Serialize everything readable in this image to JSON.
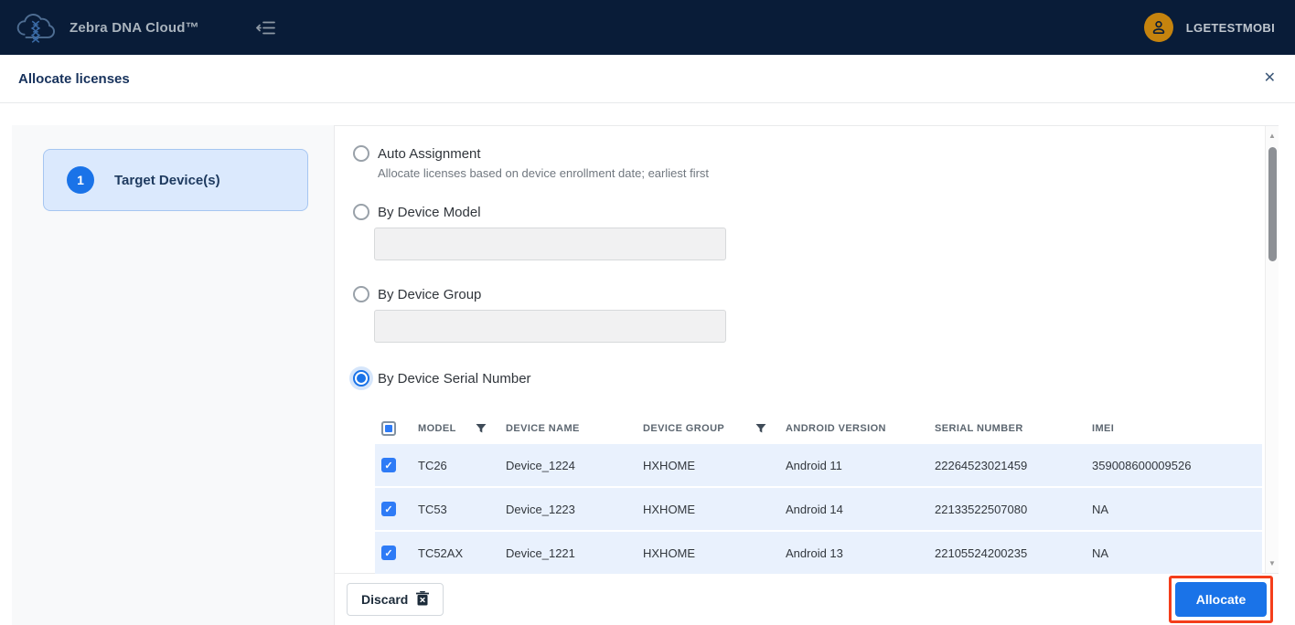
{
  "colors": {
    "header_bg": "#091c38",
    "accent_blue": "#1a73e8",
    "selected_row_bg": "#e9f1fd",
    "highlight_red": "#f43e1b",
    "avatar_gold": "#c5830e",
    "step_card_bg": "#dbe9fd"
  },
  "header": {
    "app_title": "Zebra DNA Cloud™",
    "username": "LGETESTMOBI"
  },
  "dialog": {
    "title": "Allocate licenses",
    "close_glyph": "✕"
  },
  "steps": {
    "step1": {
      "number": "1",
      "label": "Target Device(s)"
    }
  },
  "options": {
    "auto": {
      "label": "Auto Assignment",
      "description": "Allocate licenses based on device enrollment date; earliest first",
      "selected": false
    },
    "model": {
      "label": "By Device Model",
      "value": "",
      "selected": false
    },
    "group": {
      "label": "By Device Group",
      "value": "",
      "selected": false
    },
    "serial": {
      "label": "By Device Serial Number",
      "selected": true
    }
  },
  "table": {
    "columns": {
      "model": "MODEL",
      "device_name": "DEVICE NAME",
      "device_group": "DEVICE GROUP",
      "android_version": "ANDROID VERSION",
      "serial_number": "SERIAL NUMBER",
      "imei": "IMEI"
    },
    "check_glyph": "✓",
    "rows": [
      {
        "checked": true,
        "model": "TC26",
        "device_name": "Device_1224",
        "device_group": "HXHOME",
        "android_version": "Android 11",
        "serial_number": "22264523021459",
        "imei": "359008600009526"
      },
      {
        "checked": true,
        "model": "TC53",
        "device_name": "Device_1223",
        "device_group": "HXHOME",
        "android_version": "Android 14",
        "serial_number": "22133522507080",
        "imei": "NA"
      },
      {
        "checked": true,
        "model": "TC52AX",
        "device_name": "Device_1221",
        "device_group": "HXHOME",
        "android_version": "Android 13",
        "serial_number": "22105524200235",
        "imei": "NA"
      }
    ]
  },
  "scrollbar": {
    "up_glyph": "▲",
    "down_glyph": "▼"
  },
  "footer": {
    "discard_label": "Discard",
    "allocate_label": "Allocate"
  }
}
